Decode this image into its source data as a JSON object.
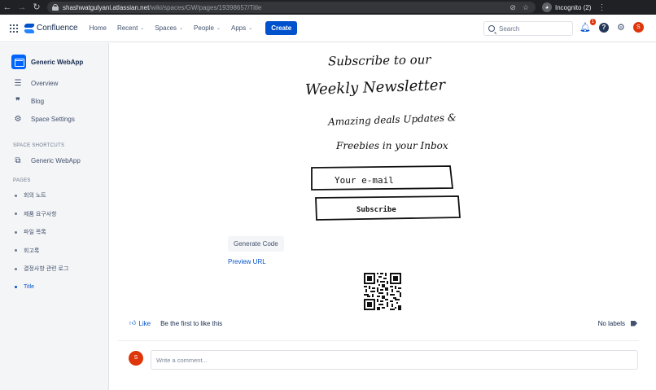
{
  "browser": {
    "url_host": "shashwatgulyani.atlassian.net",
    "url_path": "/wiki/spaces/GW/pages/19398657/Title",
    "incognito_label": "Incognito (2)"
  },
  "header": {
    "logo_text": "Confluence",
    "nav": [
      {
        "label": "Home",
        "dropdown": false
      },
      {
        "label": "Recent",
        "dropdown": true
      },
      {
        "label": "Spaces",
        "dropdown": true
      },
      {
        "label": "People",
        "dropdown": true
      },
      {
        "label": "Apps",
        "dropdown": true
      }
    ],
    "create_label": "Create",
    "search_placeholder": "Search",
    "notification_count": "1",
    "avatar_initial": "S"
  },
  "sidebar": {
    "space_name": "Generic WebApp",
    "links": [
      {
        "label": "Overview",
        "icon": "overview-icon"
      },
      {
        "label": "Blog",
        "icon": "quote-icon"
      },
      {
        "label": "Space Settings",
        "icon": "gear-icon"
      }
    ],
    "shortcuts_heading": "SPACE SHORTCUTS",
    "shortcuts": [
      {
        "label": "Generic WebApp",
        "icon": "external-link-icon"
      }
    ],
    "pages_heading": "PAGES",
    "pages": [
      {
        "label": "회의 노트",
        "active": false
      },
      {
        "label": "제품 요구사항",
        "active": false
      },
      {
        "label": "파일 목록",
        "active": false
      },
      {
        "label": "회고록",
        "active": false
      },
      {
        "label": "결정사항 관련 로그",
        "active": false
      },
      {
        "label": "Title",
        "active": true
      }
    ]
  },
  "content": {
    "sketch_lines": [
      "Subscribe to our",
      "Weekly Newsletter",
      "Amazing deals Updates &",
      "Freebies in your Inbox"
    ],
    "sketch_input": "Your e-mail",
    "sketch_button": "Subscribe",
    "generate_label": "Generate Code",
    "preview_label": "Preview URL",
    "like_label": "Like",
    "first_like_text": "Be the first to like this",
    "labels_text": "No labels",
    "comment_placeholder": "Write a comment...",
    "comment_avatar": "S"
  },
  "colors": {
    "accent": "#0052cc",
    "avatar": "#de350b",
    "sidebar_bg": "#f4f5f7"
  }
}
